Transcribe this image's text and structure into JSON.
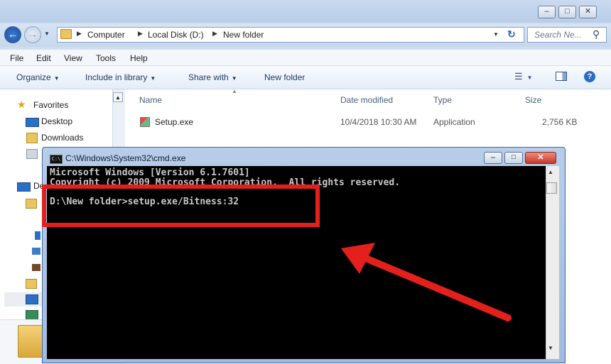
{
  "explorer": {
    "breadcrumb": [
      "Computer",
      "Local Disk (D:)",
      "New folder"
    ],
    "search_placeholder": "Search Ne...",
    "menu": [
      "File",
      "Edit",
      "View",
      "Tools",
      "Help"
    ],
    "toolbar": {
      "organize": "Organize",
      "include_in_library": "Include in library",
      "share_with": "Share with",
      "new_folder": "New folder"
    },
    "nav": {
      "favorites": "Favorites",
      "desktop": "Desktop",
      "downloads": "Downloads",
      "partial_item": "De"
    },
    "columns": [
      "Name",
      "Date modified",
      "Type",
      "Size"
    ],
    "files": [
      {
        "name": "Setup.exe",
        "date": "10/4/2018 10:30 AM",
        "type": "Application",
        "size": "2,756 KB"
      }
    ]
  },
  "cmd": {
    "title": "C:\\Windows\\System32\\cmd.exe",
    "lines": [
      "Microsoft Windows [Version 6.1.7601]",
      "Copyright (c) 2009 Microsoft Corporation.  All rights reserved.",
      "",
      "D:\\New folder>setup.exe/Bitness:32"
    ]
  },
  "colors": {
    "highlight": "#e3201b",
    "cmd_background": "#000000",
    "cmd_text": "#c8c8c8"
  }
}
